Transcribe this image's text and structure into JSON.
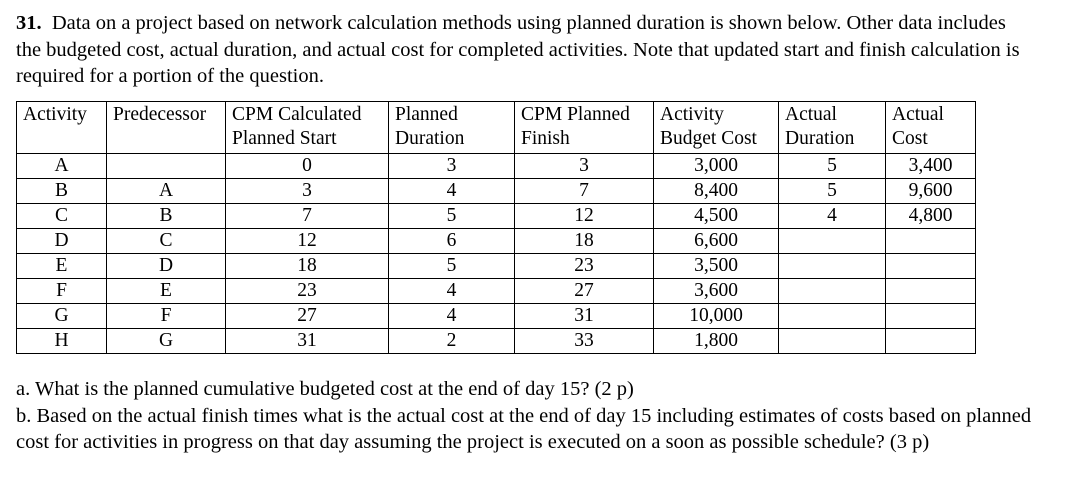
{
  "question": {
    "number": "31",
    "number_suffix": ".",
    "intro": "Data on a project based on network calculation methods using planned duration is shown below. Other data includes the budgeted cost, actual duration, and actual cost for completed activities. Note that updated start and finish calculation is required for a portion of the question."
  },
  "table": {
    "headers": [
      {
        "line1": "Activity",
        "line2": ""
      },
      {
        "line1": "Predecessor",
        "line2": ""
      },
      {
        "line1": "CPM Calculated",
        "line2": "Planned Start"
      },
      {
        "line1": "Planned",
        "line2": "Duration"
      },
      {
        "line1": "CPM Planned",
        "line2": "Finish"
      },
      {
        "line1": "Activity",
        "line2": "Budget Cost"
      },
      {
        "line1": "Actual",
        "line2": "Duration"
      },
      {
        "line1": "Actual",
        "line2": "Cost"
      }
    ],
    "rows": [
      {
        "activity": "A",
        "predecessor": "",
        "cpm_planned_start": "0",
        "planned_duration": "3",
        "cpm_planned_finish": "3",
        "activity_budget_cost": "3,000",
        "actual_duration": "5",
        "actual_cost": "3,400"
      },
      {
        "activity": "B",
        "predecessor": "A",
        "cpm_planned_start": "3",
        "planned_duration": "4",
        "cpm_planned_finish": "7",
        "activity_budget_cost": "8,400",
        "actual_duration": "5",
        "actual_cost": "9,600"
      },
      {
        "activity": "C",
        "predecessor": "B",
        "cpm_planned_start": "7",
        "planned_duration": "5",
        "cpm_planned_finish": "12",
        "activity_budget_cost": "4,500",
        "actual_duration": "4",
        "actual_cost": "4,800"
      },
      {
        "activity": "D",
        "predecessor": "C",
        "cpm_planned_start": "12",
        "planned_duration": "6",
        "cpm_planned_finish": "18",
        "activity_budget_cost": "6,600",
        "actual_duration": "",
        "actual_cost": ""
      },
      {
        "activity": "E",
        "predecessor": "D",
        "cpm_planned_start": "18",
        "planned_duration": "5",
        "cpm_planned_finish": "23",
        "activity_budget_cost": "3,500",
        "actual_duration": "",
        "actual_cost": ""
      },
      {
        "activity": "F",
        "predecessor": "E",
        "cpm_planned_start": "23",
        "planned_duration": "4",
        "cpm_planned_finish": "27",
        "activity_budget_cost": "3,600",
        "actual_duration": "",
        "actual_cost": ""
      },
      {
        "activity": "G",
        "predecessor": "F",
        "cpm_planned_start": "27",
        "planned_duration": "4",
        "cpm_planned_finish": "31",
        "activity_budget_cost": "10,000",
        "actual_duration": "",
        "actual_cost": ""
      },
      {
        "activity": "H",
        "predecessor": "G",
        "cpm_planned_start": "31",
        "planned_duration": "2",
        "cpm_planned_finish": "33",
        "activity_budget_cost": "1,800",
        "actual_duration": "",
        "actual_cost": ""
      }
    ]
  },
  "sub_questions": [
    "a. What is the planned cumulative budgeted cost at the end of day 15? (2 p)",
    "b. Based on the actual finish times what is the actual cost at the end of day 15 including estimates of costs based on planned cost for activities in progress on that day assuming the project is executed on a soon as possible schedule? (3 p)"
  ]
}
